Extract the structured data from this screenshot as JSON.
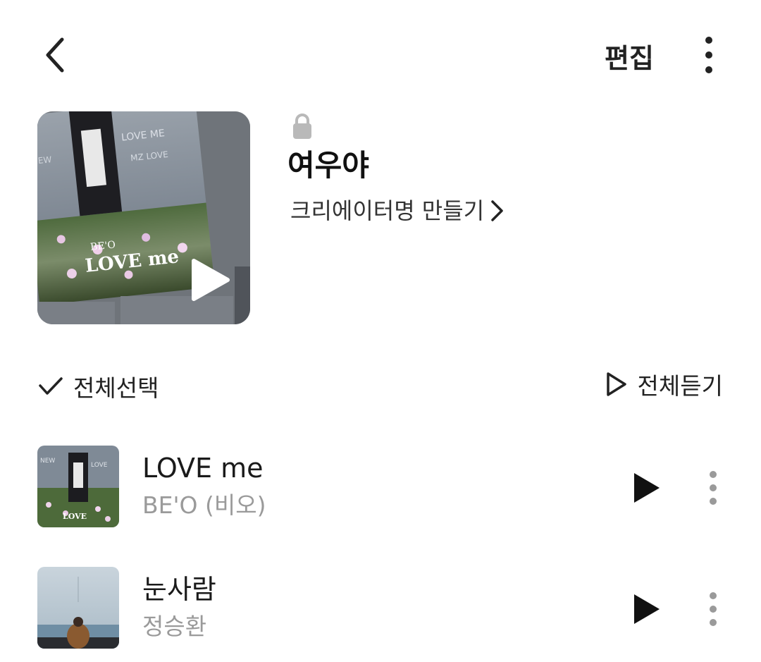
{
  "header": {
    "back_icon": "chevron-left-icon",
    "edit_label": "편집",
    "more_icon": "more-vertical-icon"
  },
  "playlist": {
    "title": "여우야",
    "creator_label": "크리에이터명 만들기",
    "lock_icon": "lock-icon",
    "cover_album_text": "LOVE me",
    "cover_brand_text": "BE'O"
  },
  "actions": {
    "select_all_label": "전체선택",
    "play_all_label": "전체듣기"
  },
  "tracks": [
    {
      "title": "LOVE me",
      "artist": "BE'O (비오)"
    },
    {
      "title": "눈사람",
      "artist": "정승환"
    }
  ],
  "colors": {
    "text_primary": "#222222",
    "text_secondary": "#9a9a9a",
    "icon_gray": "#b9b9b9"
  }
}
